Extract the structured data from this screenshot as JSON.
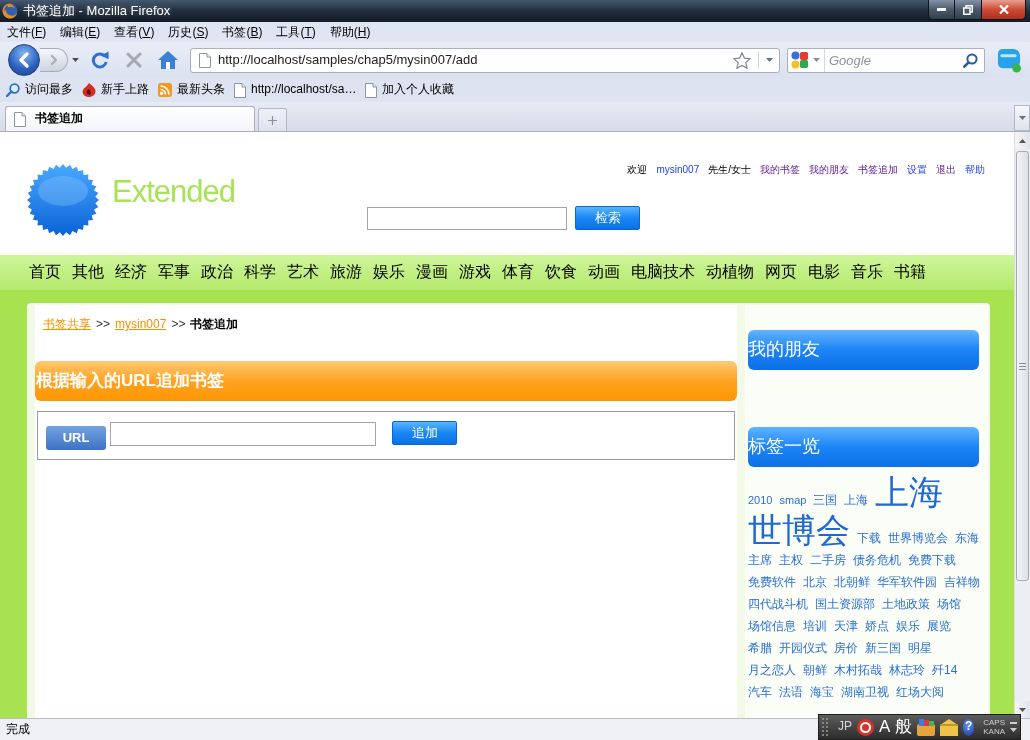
{
  "window": {
    "title": "书签追加 - Mozilla Firefox"
  },
  "menu_bar": [
    "文件(F)",
    "编辑(E)",
    "查看(V)",
    "历史(S)",
    "书签(B)",
    "工具(T)",
    "帮助(H)"
  ],
  "navigation": {
    "can_go_forward": false,
    "url": "http://localhost/samples/chap5/mysin007/add",
    "search_placeholder": "Google"
  },
  "bookmarks_bar": [
    {
      "label": "访问最多",
      "kind": "smart"
    },
    {
      "label": "新手上路",
      "kind": "guide"
    },
    {
      "label": "最新头条",
      "kind": "feed"
    },
    {
      "label": "http://localhost/sa…",
      "kind": "page"
    },
    {
      "label": "加入个人收藏",
      "kind": "page"
    }
  ],
  "tabs": [
    {
      "label": "书签追加",
      "selected": true
    }
  ],
  "page": {
    "logo_text": "Extended",
    "user_links": [
      {
        "text": "欢迎",
        "kind": "text"
      },
      {
        "text": "mysin007",
        "kind": "link",
        "visited": false
      },
      {
        "text": "先生/女士",
        "kind": "text"
      },
      {
        "text": "我的书签",
        "kind": "link",
        "visited": true
      },
      {
        "text": "我的朋友",
        "kind": "link",
        "visited": true
      },
      {
        "text": "书签追加",
        "kind": "link",
        "visited": true
      },
      {
        "text": "设置",
        "kind": "link",
        "visited": false
      },
      {
        "text": "退出",
        "kind": "link",
        "visited": true
      },
      {
        "text": "帮助",
        "kind": "link",
        "visited": false
      }
    ],
    "search": {
      "button": "检索"
    },
    "categories": [
      "首页",
      "其他",
      "经济",
      "军事",
      "政治",
      "科学",
      "艺术",
      "旅游",
      "娱乐",
      "漫画",
      "游戏",
      "体育",
      "饮食",
      "动画",
      "电脑技术",
      "动植物",
      "网页",
      "电影",
      "音乐",
      "书籍"
    ],
    "breadcrumb": [
      {
        "text": "书签共享",
        "kind": "link"
      },
      {
        "text": ">>",
        "kind": "separator"
      },
      {
        "text": "mysin007",
        "kind": "link"
      },
      {
        "text": ">>",
        "kind": "separator"
      },
      {
        "text": "书签追加",
        "kind": "current"
      }
    ],
    "main": {
      "title": "根据输入的URL追加书签",
      "url_label": "URL",
      "add_button": "追加"
    },
    "sidebar": [
      {
        "title": "我的朋友"
      },
      {
        "title": "标签一览",
        "tags": [
          {
            "text": "2010",
            "kind": "small"
          },
          {
            "text": "smap",
            "kind": "small"
          },
          {
            "text": "三国",
            "kind": "normal"
          },
          {
            "text": "上海",
            "kind": "normal"
          },
          {
            "text": "上海",
            "kind": "large"
          },
          {
            "text": "世博会",
            "kind": "large"
          },
          {
            "text": "下载",
            "kind": "normal"
          },
          {
            "text": "世界博览会",
            "kind": "normal"
          },
          {
            "text": "东海",
            "kind": "normal"
          },
          {
            "text": "主席",
            "kind": "normal"
          },
          {
            "text": "主权",
            "kind": "normal"
          },
          {
            "text": "二手房",
            "kind": "normal"
          },
          {
            "text": "债务危机",
            "kind": "normal"
          },
          {
            "text": "免费下载",
            "kind": "normal"
          },
          {
            "text": "免费软件",
            "kind": "normal"
          },
          {
            "text": "北京",
            "kind": "normal"
          },
          {
            "text": "北朝鲜",
            "kind": "normal"
          },
          {
            "text": "华军软件园",
            "kind": "normal"
          },
          {
            "text": "吉祥物",
            "kind": "normal"
          },
          {
            "text": "四代战斗机",
            "kind": "normal"
          },
          {
            "text": "国土资源部",
            "kind": "normal"
          },
          {
            "text": "土地政策",
            "kind": "normal"
          },
          {
            "text": "场馆",
            "kind": "normal"
          },
          {
            "text": "场馆信息",
            "kind": "normal"
          },
          {
            "text": "培训",
            "kind": "normal"
          },
          {
            "text": "天津",
            "kind": "normal"
          },
          {
            "text": "娇点",
            "kind": "normal"
          },
          {
            "text": "娱乐",
            "kind": "normal"
          },
          {
            "text": "展览",
            "kind": "normal"
          },
          {
            "text": "希腊",
            "kind": "normal"
          },
          {
            "text": "开园仪式",
            "kind": "normal"
          },
          {
            "text": "房价",
            "kind": "normal"
          },
          {
            "text": "新三国",
            "kind": "normal"
          },
          {
            "text": "明星",
            "kind": "normal"
          },
          {
            "text": "月之恋人",
            "kind": "normal"
          },
          {
            "text": "朝鲜",
            "kind": "normal"
          },
          {
            "text": "木村拓哉",
            "kind": "normal"
          },
          {
            "text": "林志玲",
            "kind": "normal"
          },
          {
            "text": "歼14",
            "kind": "normal"
          },
          {
            "text": "汽车",
            "kind": "normal"
          },
          {
            "text": "法语",
            "kind": "normal"
          },
          {
            "text": "海宝",
            "kind": "normal"
          },
          {
            "text": "湖南卫视",
            "kind": "normal"
          },
          {
            "text": "红场大阅",
            "kind": "normal"
          }
        ]
      }
    ]
  },
  "status_bar": {
    "text": "完成"
  },
  "ime_bar": {
    "language": "JP",
    "input_mode": "A",
    "conversion_mode": "般",
    "help": "?",
    "caps": "CAPS",
    "kana": "KANA"
  }
}
